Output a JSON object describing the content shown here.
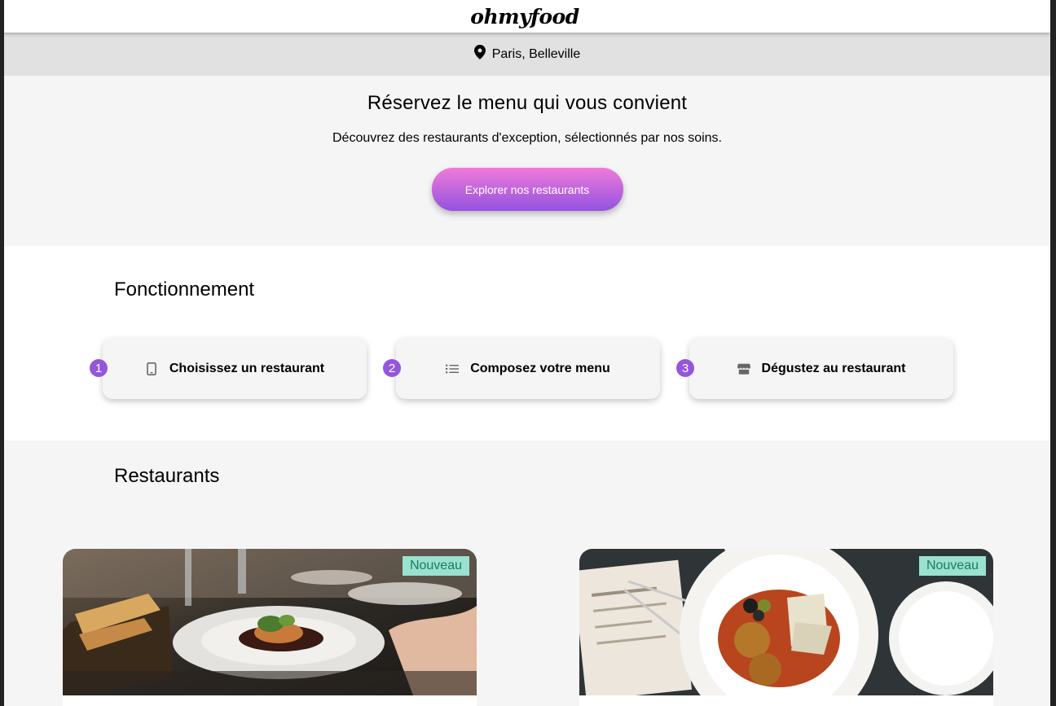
{
  "header": {
    "logo": "ohmyfood"
  },
  "location": {
    "text": "Paris, Belleville",
    "icon": "map-pin-icon"
  },
  "hero": {
    "title": "Réservez le menu qui vous convient",
    "subtitle": "Découvrez des restaurants d'exception, sélectionnés par nos soins.",
    "cta_label": "Explorer nos restaurants"
  },
  "how": {
    "title": "Fonctionnement",
    "steps": [
      {
        "number": "1",
        "label": "Choisissez un restaurant",
        "icon": "mobile-phone-icon"
      },
      {
        "number": "2",
        "label": "Composez votre menu",
        "icon": "list-icon"
      },
      {
        "number": "3",
        "label": "Dégustez au restaurant",
        "icon": "store-icon"
      }
    ]
  },
  "restaurants": {
    "title": "Restaurants",
    "cards": [
      {
        "badge": "Nouveau"
      },
      {
        "badge": "Nouveau"
      }
    ]
  },
  "colors": {
    "accent": "#9356dc",
    "accent_pink": "#f07bd9",
    "badge_bg": "#99e2d0",
    "badge_text": "#1f7a5c"
  }
}
